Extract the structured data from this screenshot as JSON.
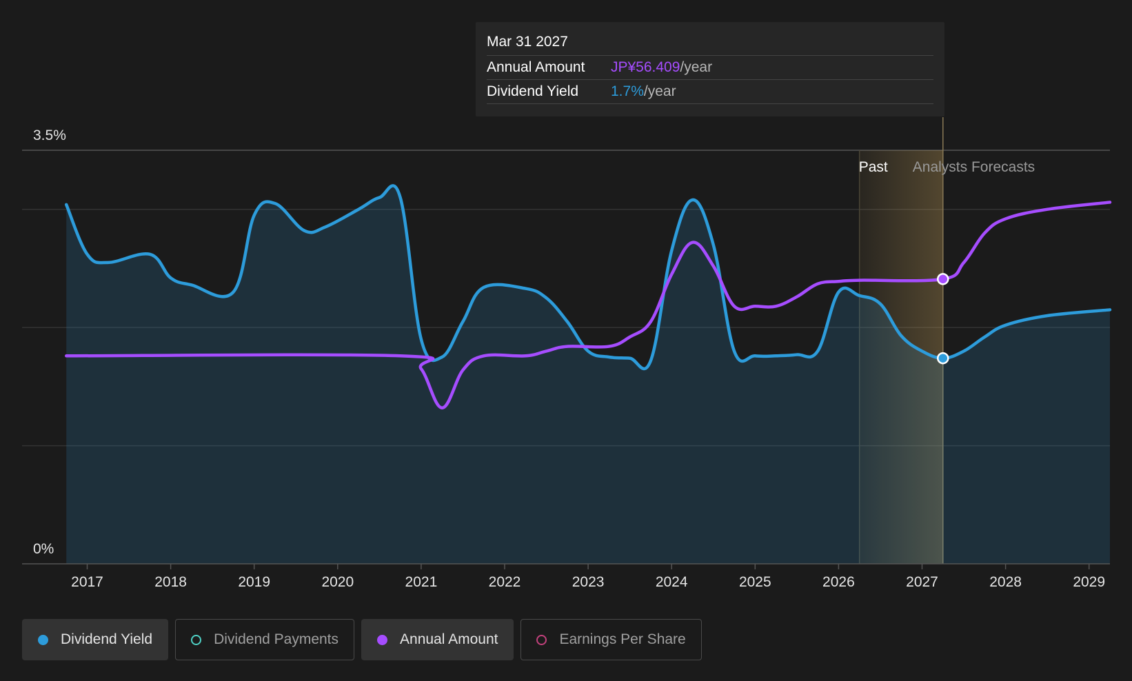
{
  "tooltip": {
    "date": "Mar 31 2027",
    "annual_label": "Annual Amount",
    "annual_value": "JP¥56.409",
    "annual_suffix": "/year",
    "yield_label": "Dividend Yield",
    "yield_value": "1.7%",
    "yield_suffix": "/year"
  },
  "colors": {
    "dividend_yield": "#2d9cdb",
    "annual_amount": "#a64dff",
    "dividend_payments": "#4fd1c5",
    "earnings_per_share": "#c2417c",
    "forecast_band": "#c9a35a",
    "background": "#1b1b1b"
  },
  "legend": [
    {
      "label": "Dividend Yield",
      "color": "#2d9cdb",
      "active": true,
      "icon": "filled-dot-icon"
    },
    {
      "label": "Dividend Payments",
      "color": "#4fd1c5",
      "active": false,
      "icon": "hollow-dot-icon"
    },
    {
      "label": "Annual Amount",
      "color": "#a64dff",
      "active": true,
      "icon": "filled-dot-icon"
    },
    {
      "label": "Earnings Per Share",
      "color": "#c2417c",
      "active": false,
      "icon": "hollow-dot-icon"
    }
  ],
  "chart_data": {
    "type": "line",
    "title": "",
    "xlabel": "",
    "ylabel": "",
    "ylim": [
      0,
      3.5
    ],
    "xlim": [
      2016.75,
      2029.25
    ],
    "y_tick_labels": [
      {
        "value": 3.5,
        "label": "3.5%"
      },
      {
        "value": 0,
        "label": "0%"
      }
    ],
    "x_ticks": [
      2017,
      2018,
      2019,
      2020,
      2021,
      2022,
      2023,
      2024,
      2025,
      2026,
      2027,
      2028,
      2029
    ],
    "gridlines": [
      3.5,
      3.0,
      2.0,
      1.0
    ],
    "regions": {
      "past_label": "Past",
      "forecast_label": "Analysts Forecasts",
      "past_start": 2026.25,
      "divider": 2027.25
    },
    "highlight_x": 2027.25,
    "series": [
      {
        "name": "Dividend Yield",
        "color": "#2d9cdb",
        "area": true,
        "points": [
          [
            2016.75,
            3.04
          ],
          [
            2017.0,
            2.62
          ],
          [
            2017.25,
            2.55
          ],
          [
            2017.75,
            2.62
          ],
          [
            2018.0,
            2.42
          ],
          [
            2018.25,
            2.36
          ],
          [
            2018.75,
            2.3
          ],
          [
            2019.0,
            2.95
          ],
          [
            2019.25,
            3.05
          ],
          [
            2019.6,
            2.82
          ],
          [
            2019.85,
            2.85
          ],
          [
            2020.25,
            3.0
          ],
          [
            2020.5,
            3.1
          ],
          [
            2020.75,
            3.1
          ],
          [
            2021.0,
            1.9
          ],
          [
            2021.25,
            1.75
          ],
          [
            2021.5,
            2.05
          ],
          [
            2021.75,
            2.34
          ],
          [
            2022.25,
            2.33
          ],
          [
            2022.5,
            2.25
          ],
          [
            2022.75,
            2.05
          ],
          [
            2023.0,
            1.8
          ],
          [
            2023.25,
            1.75
          ],
          [
            2023.5,
            1.74
          ],
          [
            2023.75,
            1.72
          ],
          [
            2024.0,
            2.65
          ],
          [
            2024.25,
            3.08
          ],
          [
            2024.5,
            2.7
          ],
          [
            2024.75,
            1.8
          ],
          [
            2025.0,
            1.76
          ],
          [
            2025.25,
            1.76
          ],
          [
            2025.5,
            1.77
          ],
          [
            2025.75,
            1.8
          ],
          [
            2026.0,
            2.3
          ],
          [
            2026.25,
            2.27
          ],
          [
            2026.5,
            2.2
          ],
          [
            2026.75,
            1.93
          ],
          [
            2027.0,
            1.8
          ],
          [
            2027.25,
            1.74
          ],
          [
            2027.5,
            1.8
          ],
          [
            2027.75,
            1.92
          ],
          [
            2028.0,
            2.02
          ],
          [
            2028.5,
            2.1
          ],
          [
            2029.25,
            2.15
          ]
        ]
      },
      {
        "name": "Annual Amount",
        "color": "#a64dff",
        "area": false,
        "points": [
          [
            2016.75,
            1.76
          ],
          [
            2020.75,
            1.76
          ],
          [
            2021.0,
            1.65
          ],
          [
            2021.25,
            1.32
          ],
          [
            2021.5,
            1.64
          ],
          [
            2021.75,
            1.76
          ],
          [
            2022.25,
            1.76
          ],
          [
            2022.5,
            1.8
          ],
          [
            2022.75,
            1.84
          ],
          [
            2023.25,
            1.84
          ],
          [
            2023.5,
            1.92
          ],
          [
            2023.75,
            2.05
          ],
          [
            2024.0,
            2.45
          ],
          [
            2024.25,
            2.72
          ],
          [
            2024.5,
            2.52
          ],
          [
            2024.75,
            2.18
          ],
          [
            2025.0,
            2.18
          ],
          [
            2025.25,
            2.18
          ],
          [
            2025.5,
            2.26
          ],
          [
            2025.75,
            2.37
          ],
          [
            2026.0,
            2.39
          ],
          [
            2026.25,
            2.4
          ],
          [
            2027.25,
            2.41
          ],
          [
            2027.5,
            2.55
          ],
          [
            2027.75,
            2.8
          ],
          [
            2028.0,
            2.92
          ],
          [
            2028.5,
            3.0
          ],
          [
            2029.25,
            3.06
          ]
        ]
      }
    ],
    "markers": [
      {
        "series": "Annual Amount",
        "x": 2027.25,
        "y": 2.41
      },
      {
        "series": "Dividend Yield",
        "x": 2027.25,
        "y": 1.74
      }
    ]
  }
}
